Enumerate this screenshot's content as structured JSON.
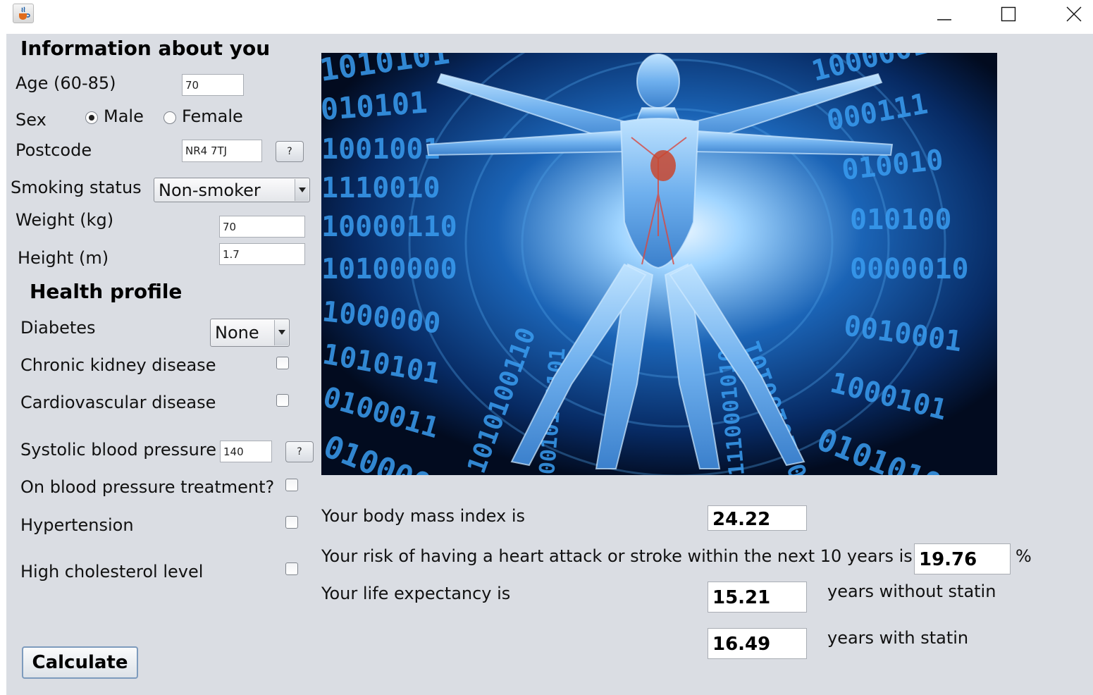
{
  "window": {
    "title": "",
    "app_icon": "java-cup-icon",
    "controls": [
      "minimize-icon",
      "maximize-icon",
      "close-icon"
    ]
  },
  "info": {
    "heading": "Information about you",
    "age_label": "Age (60-85)",
    "age_value": "70",
    "sex_label": "Sex",
    "sex_options": [
      {
        "label": "Male",
        "selected": true
      },
      {
        "label": "Female",
        "selected": false
      }
    ],
    "postcode_label": "Postcode",
    "postcode_value": "NR4 7TJ",
    "postcode_help": "?",
    "smoking_label": "Smoking status",
    "smoking_value": "Non-smoker",
    "weight_label": "Weight (kg)",
    "weight_value": "70",
    "height_label": "Height (m)",
    "height_value": "1.7"
  },
  "health": {
    "heading": "Health profile",
    "diabetes_label": "Diabetes",
    "diabetes_value": "None",
    "ckd_label": "Chronic kidney disease",
    "ckd_checked": false,
    "cvd_label": "Cardiovascular disease",
    "cvd_checked": false,
    "sbp_label": "Systolic blood pressure",
    "sbp_value": "140",
    "sbp_help": "?",
    "bp_treatment_label": "On blood pressure treatment?",
    "bp_treatment_checked": false,
    "hypertension_label": "Hypertension",
    "hypertension_checked": false,
    "cholesterol_label": "High cholesterol level",
    "cholesterol_checked": false
  },
  "calculate_label": "Calculate",
  "results": {
    "bmi_label": "Your body mass index is",
    "bmi_value": "24.22",
    "risk_label": "Your risk of having a heart attack or stroke within the next 10 years is",
    "risk_value": "19.76",
    "risk_unit": "%",
    "life_label": "Your life expectancy is",
    "life_without_value": "15.21",
    "life_without_label": "years without statin",
    "life_with_value": "16.49",
    "life_with_label": "years with statin"
  },
  "colors": {
    "panel_bg": "#dadde3",
    "picture_dark": "#03122c",
    "picture_glow": "#9fd4ff",
    "binary_text": "#2f8fe0"
  }
}
